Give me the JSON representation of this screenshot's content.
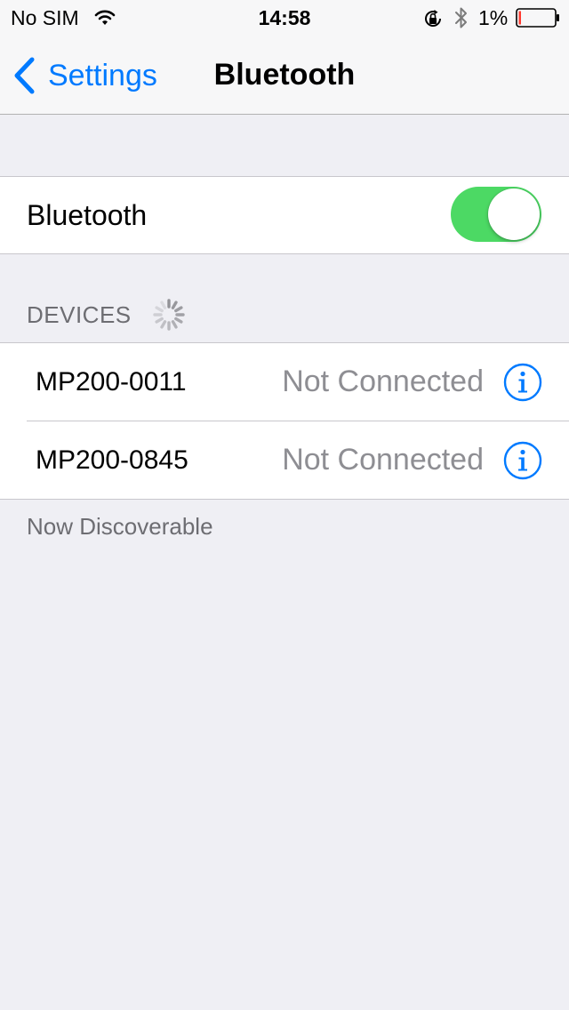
{
  "status_bar": {
    "carrier": "No SIM",
    "time": "14:58",
    "battery_percent": "1%"
  },
  "nav": {
    "back_label": "Settings",
    "title": "Bluetooth"
  },
  "bluetooth": {
    "label": "Bluetooth",
    "enabled": true
  },
  "devices": {
    "header": "DEVICES",
    "items": [
      {
        "name": "MP200-0011",
        "status": "Not Connected"
      },
      {
        "name": "MP200-0845",
        "status": "Not Connected"
      }
    ]
  },
  "footer": "Now Discoverable",
  "colors": {
    "accent": "#007aff",
    "toggle_on": "#4cd964",
    "battery_low": "#ff3b30",
    "background": "#efeff4"
  },
  "icons": {
    "wifi": "wifi-icon",
    "lock": "rotation-lock-icon",
    "bluetooth": "bluetooth-icon",
    "battery": "battery-icon",
    "back": "chevron-left-icon",
    "spinner": "activity-spinner-icon",
    "info": "info-icon"
  }
}
